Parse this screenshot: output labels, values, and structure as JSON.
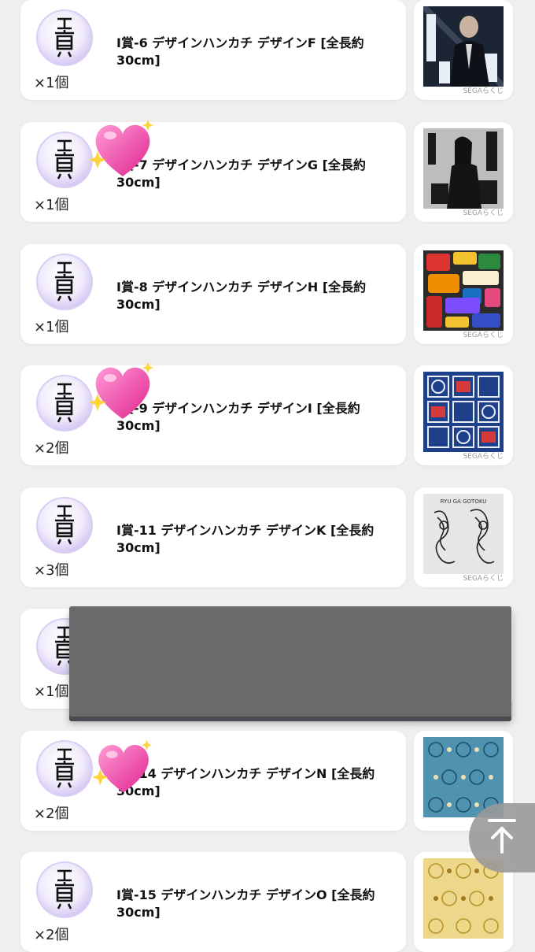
{
  "items": [
    {
      "badge": "I賞",
      "title": "I賞-6 デザインハンカチ デザインF [全長約30cm]",
      "qty": "×1個",
      "thumb": "kamiya-portrait"
    },
    {
      "badge": "I賞",
      "title": "I賞-7 デザインハンカチ デザインG [全長約30cm]",
      "qty": "×1個",
      "thumb": "yamai-portrait"
    },
    {
      "badge": "I賞",
      "title": "I賞-8 デザインハンカチ デザインH [全長約30cm]",
      "qty": "×1個",
      "thumb": "sticker-collage"
    },
    {
      "badge": "I賞",
      "title": "I賞-9 デザインハンカチ デザインI [全長約30cm]",
      "qty": "×2個",
      "thumb": "blue-pattern"
    },
    {
      "badge": "I賞",
      "title": "I賞-11 デザインハンカチ デザインK [全長約30cm]",
      "qty": "×3個",
      "thumb": "ryu-ga-gotoku-tattoo"
    },
    {
      "badge": "I賞",
      "title": "",
      "qty": "×1個",
      "thumb": ""
    },
    {
      "badge": "I賞",
      "title": "I賞-14 デザインハンカチ デザインN [全長約30cm]",
      "qty": "×2個",
      "thumb": "teal-pattern"
    },
    {
      "badge": "I賞",
      "title": "I賞-15 デザインハンカチ デザインO [全長約30cm]",
      "qty": "×2個",
      "thumb": "gold-pattern"
    }
  ],
  "thumb_text": {
    "ryu_ga_gotoku": "RYU GA GOTOKU",
    "watermark": "SEGAらくじ"
  },
  "scroll_top": {
    "icon": "arrow-up-to-line-icon"
  },
  "colors": {
    "background": "#efefef",
    "badge": "#cbbdf0",
    "overlay": "#6a6a6a"
  }
}
